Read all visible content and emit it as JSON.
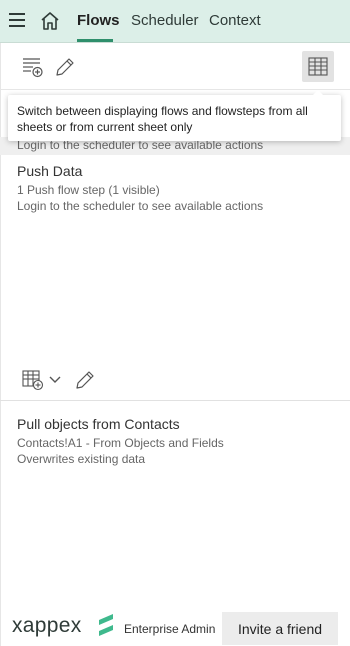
{
  "nav": {
    "tabs": [
      {
        "label": "Flows",
        "active": true
      },
      {
        "label": "Scheduler",
        "active": false
      },
      {
        "label": "Context",
        "active": false
      }
    ]
  },
  "toolbar": {
    "icons": [
      "add-flow-icon",
      "edit-icon",
      "sheet-filter-toggle-icon"
    ]
  },
  "tooltip": {
    "text": "Switch between displaying flows and flowsteps from all sheets or from current sheet only"
  },
  "flows": {
    "peek_text": "Login to the scheduler to see available actions",
    "items": [
      {
        "title": "Push Data",
        "steps": "1 Push flow step (1 visible)",
        "note": "Login to the scheduler to see available actions"
      }
    ]
  },
  "flowsteps": {
    "toolbar_icons": [
      "add-step-icon",
      "chevron-down-icon",
      "edit-icon"
    ],
    "items": [
      {
        "title": "Pull objects from Contacts",
        "location": "Contacts!A1 - From Objects and Fields",
        "mode": "Overwrites existing data"
      }
    ]
  },
  "footer": {
    "logo_text": "xappex",
    "plan": "Enterprise Admin",
    "invite_label": "Invite a friend"
  },
  "colors": {
    "nav_bg": "#dcefe8",
    "accent": "#2f8f6c",
    "logo_mark": "#3fb98d"
  }
}
